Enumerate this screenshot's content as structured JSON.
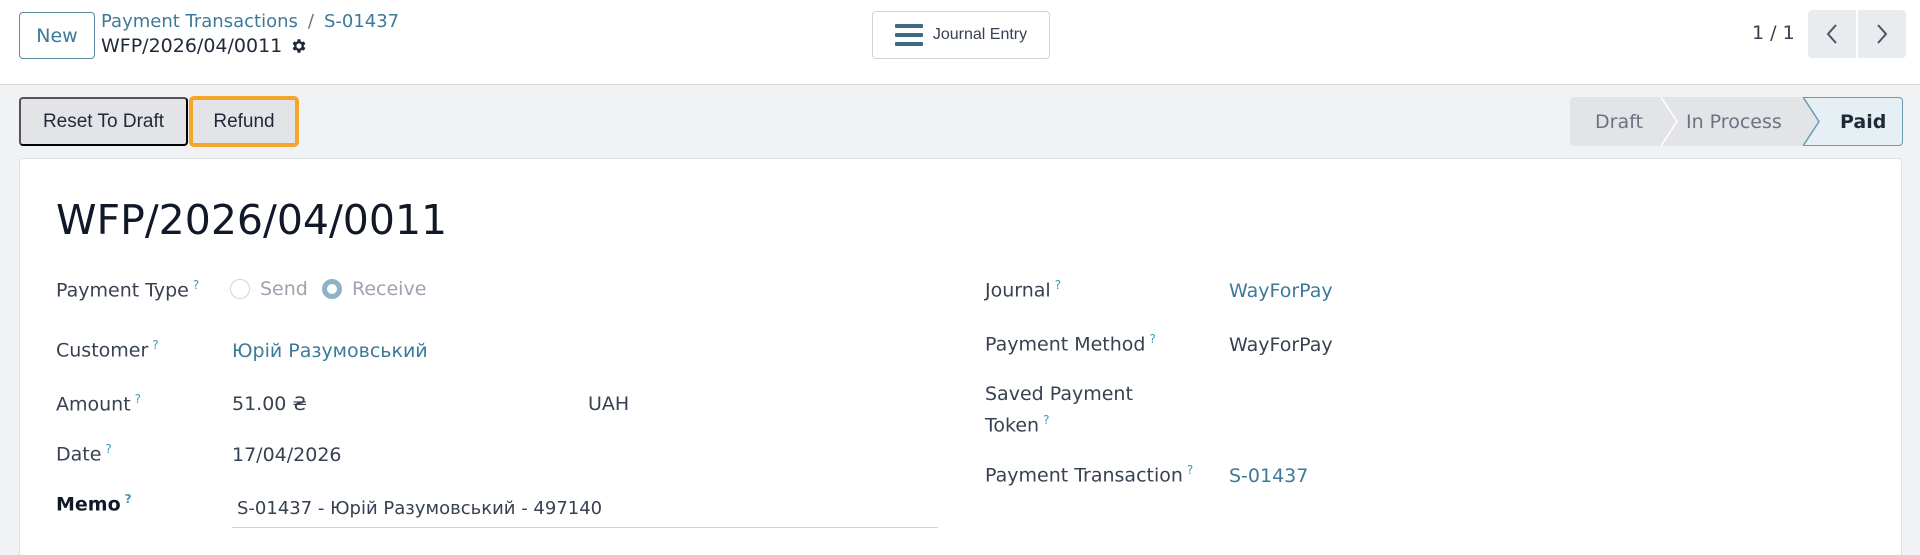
{
  "control_panel": {
    "new_label": "New",
    "breadcrumb": {
      "parent": "Payment Transactions",
      "separator": "/",
      "current": "S-01437"
    },
    "record_name": "WFP/2026/04/0011",
    "journal_entry_label": "Journal Entry",
    "pager": "1 / 1"
  },
  "actions": {
    "reset_to_draft": "Reset To Draft",
    "refund": "Refund"
  },
  "statusbar": {
    "steps": [
      "Draft",
      "In Process",
      "Paid"
    ],
    "current": "Paid"
  },
  "form": {
    "title": "WFP/2026/04/0011",
    "help_mark": "?",
    "payment_type": {
      "label": "Payment Type",
      "options": [
        "Send",
        "Receive"
      ],
      "selected": "Receive"
    },
    "customer": {
      "label": "Customer",
      "value": "Юрій Разумовський"
    },
    "amount": {
      "label": "Amount",
      "value": "51.00 ₴",
      "currency": "UAH"
    },
    "date": {
      "label": "Date",
      "value": "17/04/2026"
    },
    "memo": {
      "label": "Memo",
      "value": "S-01437 - Юрій Разумовський - 497140"
    },
    "journal": {
      "label": "Journal",
      "value": "WayForPay"
    },
    "payment_method": {
      "label": "Payment Method",
      "value": "WayForPay"
    },
    "saved_payment_token": {
      "label_line1": "Saved Payment",
      "label_line2": "Token"
    },
    "payment_transaction": {
      "label": "Payment Transaction",
      "value": "S-01437"
    }
  },
  "colors": {
    "link": "#3d7a99",
    "highlight": "#f4a52a",
    "help": "#3d9bb8"
  }
}
